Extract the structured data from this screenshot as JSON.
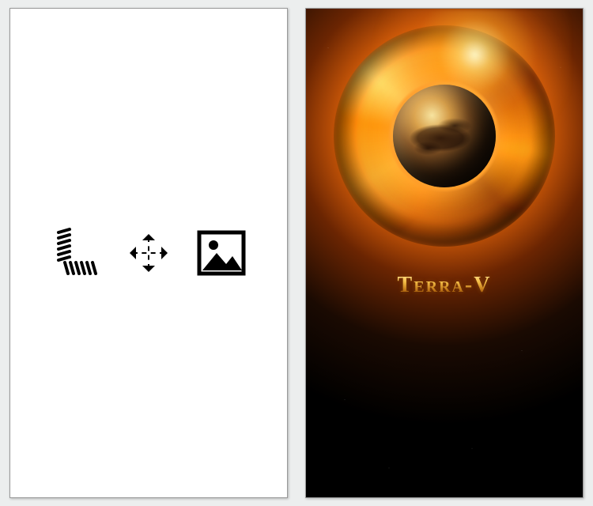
{
  "left_panel": {
    "icons": [
      "spring-icon",
      "move-icon",
      "image-placeholder-icon"
    ]
  },
  "right_panel": {
    "title": "Terra-V"
  }
}
